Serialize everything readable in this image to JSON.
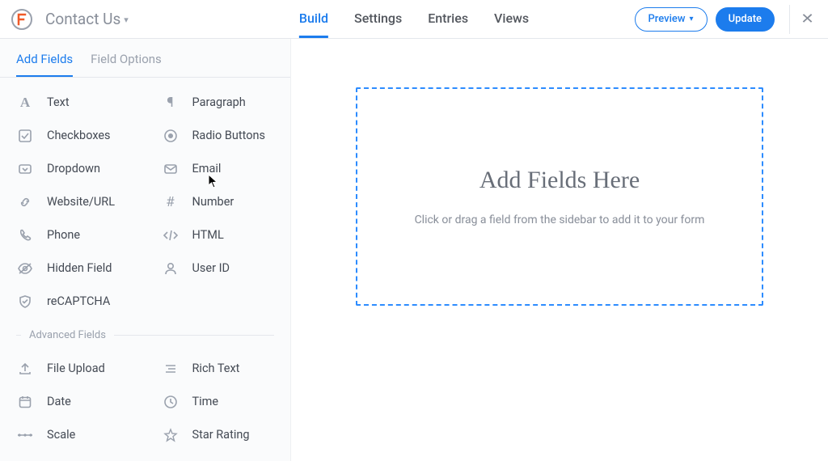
{
  "header": {
    "form_title": "Contact Us",
    "tabs": {
      "build": "Build",
      "settings": "Settings",
      "entries": "Entries",
      "views": "Views"
    },
    "preview_label": "Preview",
    "update_label": "Update"
  },
  "sidebar_tabs": {
    "add_fields": "Add Fields",
    "field_options": "Field Options"
  },
  "basic_fields": {
    "text": "Text",
    "paragraph": "Paragraph",
    "checkboxes": "Checkboxes",
    "radio": "Radio Buttons",
    "dropdown": "Dropdown",
    "email": "Email",
    "website": "Website/URL",
    "number": "Number",
    "phone": "Phone",
    "html": "HTML",
    "hidden": "Hidden Field",
    "user_id": "User ID",
    "recaptcha": "reCAPTCHA"
  },
  "advanced_section_label": "Advanced Fields",
  "advanced_fields": {
    "file_upload": "File Upload",
    "rich_text": "Rich Text",
    "date": "Date",
    "time": "Time",
    "scale": "Scale",
    "star_rating": "Star Rating"
  },
  "dropzone": {
    "title": "Add Fields Here",
    "subtitle": "Click or drag a field from the sidebar to add it to your form"
  },
  "colors": {
    "accent": "#1c7ced"
  }
}
